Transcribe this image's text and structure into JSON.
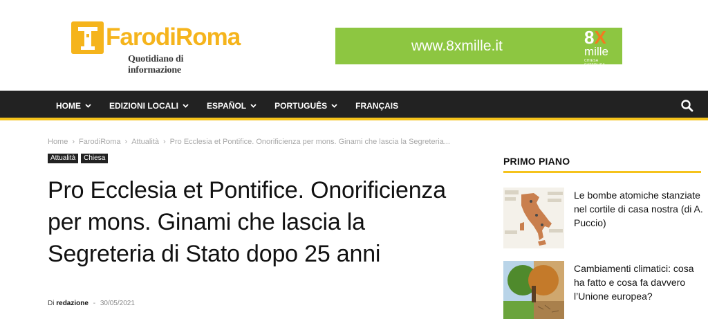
{
  "header": {
    "logo_text": "FarodiRoma",
    "logo_subtitle": "Quotidiano di informazione"
  },
  "ad": {
    "url_text": "www.8xmille.it",
    "brand_number": "8",
    "brand_x": "X",
    "brand_word": "mille",
    "brand_sub": "CHIESA CATTOLICA",
    "bg_color": "#8dc641"
  },
  "nav": {
    "items": [
      {
        "label": "HOME",
        "has_dropdown": true
      },
      {
        "label": "EDIZIONI LOCALI",
        "has_dropdown": true
      },
      {
        "label": "ESPAÑOL",
        "has_dropdown": true
      },
      {
        "label": "PORTUGUÊS",
        "has_dropdown": true
      },
      {
        "label": "FRANÇAIS",
        "has_dropdown": false
      }
    ],
    "accent": "#f5c31c",
    "search_icon": "search-icon"
  },
  "breadcrumb": {
    "items": [
      "Home",
      "FarodiRoma",
      "Attualità",
      "Pro Ecclesia et Pontifice. Onorificienza per mons. Ginami che lascia la Segreteria..."
    ],
    "separator": "›"
  },
  "article": {
    "categories": [
      "Attualità",
      "Chiesa"
    ],
    "title": "Pro Ecclesia et Pontifice. Onorificienza per mons. Ginami che lascia la Segreteria di Stato dopo 25 anni",
    "by_label": "Di",
    "author": "redazione",
    "date_separator": "-",
    "date": "30/05/2021"
  },
  "sidebar": {
    "heading": "PRIMO PIANO",
    "posts": [
      {
        "title": "Le bombe atomiche stanziate nel cortile di casa nostra (di A. Puccio)",
        "thumb": "italy-map-image"
      },
      {
        "title": "Cambiamenti climatici: cosa ha fatto e cosa fa davvero l’Unione europea?",
        "thumb": "tree-climate-image"
      }
    ]
  }
}
